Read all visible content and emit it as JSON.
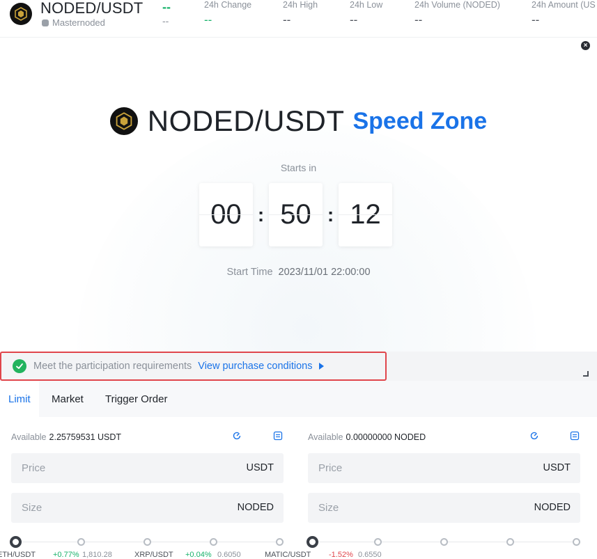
{
  "header": {
    "pair": "NODED/USDT",
    "tag": "Masternoded",
    "price": "--",
    "price_sub": "--",
    "stats": [
      {
        "label": "24h Change",
        "value": "--",
        "color": "#17b26a"
      },
      {
        "label": "24h High",
        "value": "--"
      },
      {
        "label": "24h Low",
        "value": "--"
      },
      {
        "label": "24h Volume (NODED)",
        "value": "--"
      },
      {
        "label": "24h Amount (US",
        "value": "--"
      }
    ]
  },
  "hero": {
    "close_icon": "×",
    "pair": "NODED/USDT",
    "zone": "Speed Zone",
    "starts_in": "Starts in",
    "countdown": {
      "hours": "00",
      "minutes": "50",
      "seconds": "12"
    },
    "colon": ":",
    "start_time_label": "Start Time",
    "start_time_value": "2023/11/01 22:00:00"
  },
  "requirements": {
    "text": "Meet the participation requirements",
    "link": "View purchase conditions"
  },
  "tabs": [
    "Limit",
    "Market",
    "Trigger Order"
  ],
  "buy": {
    "available_label": "Available",
    "available_value": "2.25759531 USDT",
    "price_placeholder": "Price",
    "price_unit": "USDT",
    "size_placeholder": "Size",
    "size_unit": "NODED"
  },
  "sell": {
    "available_label": "Available",
    "available_value": "0.00000000 NODED",
    "price_placeholder": "Price",
    "price_unit": "USDT",
    "size_placeholder": "Size",
    "size_unit": "NODED"
  },
  "ticker": [
    {
      "pair": "ETH/USDT",
      "change": "+0.77%",
      "price": "1,810.28"
    },
    {
      "pair": "XRP/USDT",
      "change": "+0.04%",
      "price": "0.6050"
    },
    {
      "pair": "MATIC/USDT",
      "change": "-1.52%",
      "price": "0.6550"
    }
  ],
  "colors": {
    "accent": "#1a73e8",
    "positive": "#17b26a",
    "negative": "#e0454b",
    "highlight_border": "#e0454b"
  }
}
